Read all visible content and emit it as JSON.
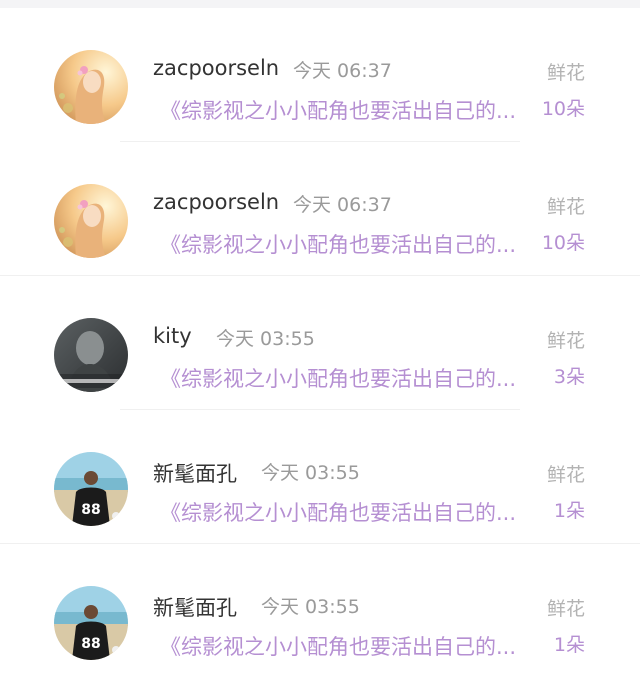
{
  "rewards": [
    {
      "username": "zacpoorseln",
      "time": "今天 06:37",
      "gift_label": "鲜花",
      "book_title": "《综影视之小小配角也要活出自己的...",
      "gift_count": "10朵",
      "avatar": "girl-flower-avatar"
    },
    {
      "username": "zacpoorseln",
      "time": "今天 06:37",
      "gift_label": "鲜花",
      "book_title": "《综影视之小小配角也要活出自己的...",
      "gift_count": "10朵",
      "avatar": "girl-flower-avatar"
    },
    {
      "username": "kity",
      "time": "今天 03:55",
      "gift_label": "鲜花",
      "book_title": "《综影视之小小配角也要活出自己的...",
      "gift_count": "3朵",
      "avatar": "dark-portrait-avatar"
    },
    {
      "username": "新髦面孔",
      "time": "今天 03:55",
      "gift_label": "鲜花",
      "book_title": "《综影视之小小配角也要活出自己的...",
      "gift_count": "1朵",
      "avatar": "beach-jersey-88-avatar"
    },
    {
      "username": "新髦面孔",
      "time": "今天 03:55",
      "gift_label": "鲜花",
      "book_title": "《综影视之小小配角也要活出自己的...",
      "gift_count": "1朵",
      "avatar": "beach-jersey-88-avatar"
    }
  ],
  "avatar_texts": {
    "jersey_number": "88"
  }
}
